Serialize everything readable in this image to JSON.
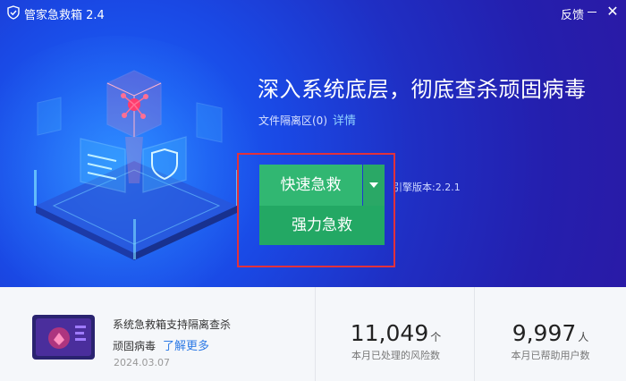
{
  "titlebar": {
    "title": "管家急救箱 2.4",
    "feedback": "反馈"
  },
  "hero": {
    "headline": "深入系统底层，彻底查杀顽固病毒",
    "quarantine_label": "文件隔离区(0)",
    "details_link": "详情",
    "quick_rescue": "快速急救",
    "strong_rescue": "强力急救",
    "engine_version": "引擎版本:2.2.1"
  },
  "news": {
    "line1": "系统急救箱支持隔离查杀",
    "line2": "顽固病毒",
    "more_link": "了解更多",
    "date": "2024.03.07"
  },
  "stats": [
    {
      "value": "11,049",
      "unit": "个",
      "label": "本月已处理的风险数"
    },
    {
      "value": "9,997",
      "unit": "人",
      "label": "本月已帮助用户数"
    }
  ],
  "colors": {
    "hero_blue": "#1f2fc4",
    "button_green": "#31b772",
    "highlight_red": "#e2313b",
    "link_blue": "#2f7be5"
  },
  "icons": {
    "app": "shield-icon",
    "close": "close-icon",
    "minimize": "minimize-icon",
    "dropdown": "chevron-down-icon"
  }
}
